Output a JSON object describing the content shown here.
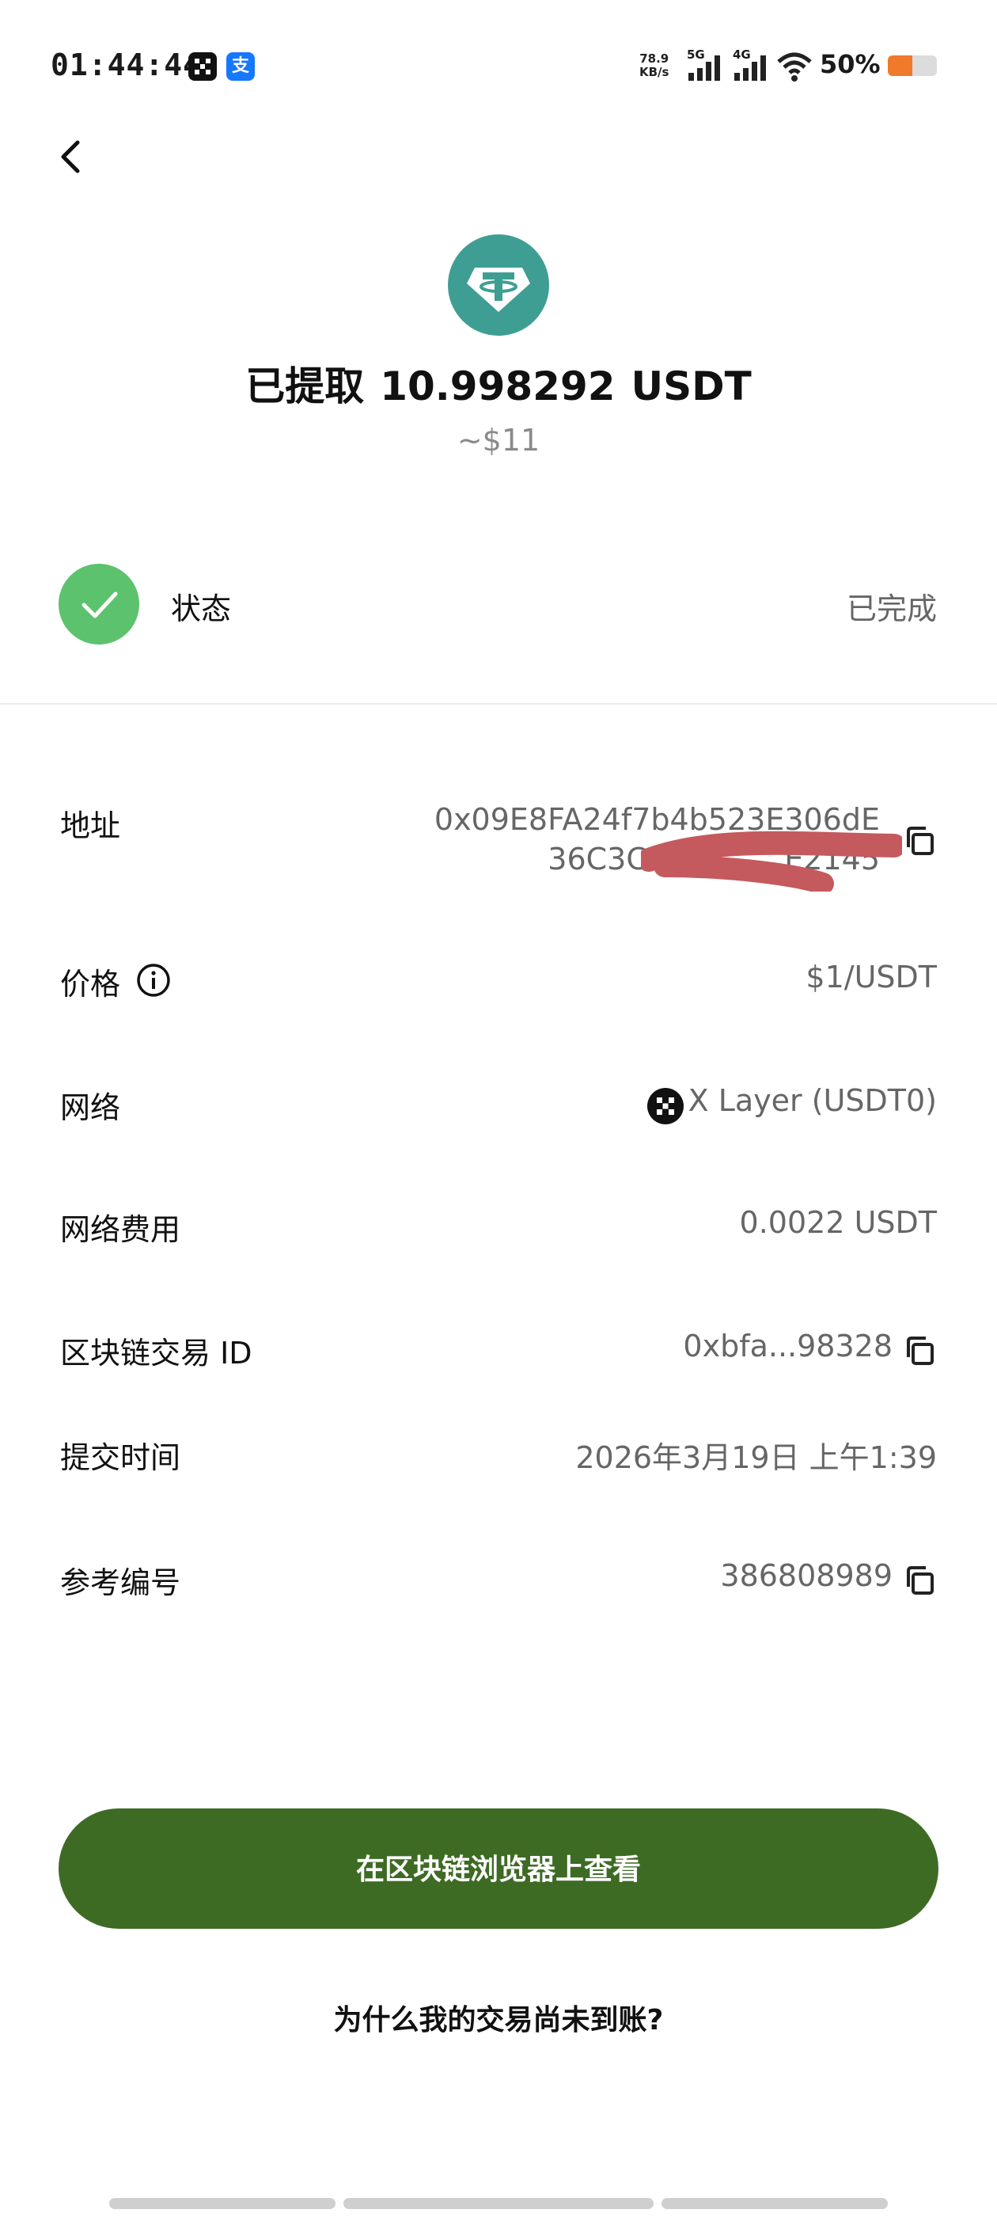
{
  "status_bar": {
    "time": "01:44:44",
    "okx_icon": "okx-icon",
    "alipay_icon_char": "支",
    "net_speed": "78.9",
    "net_speed_unit": "KB/s",
    "sim1": "5G",
    "sim2": "4G",
    "battery_text": "50%",
    "battery_level": 0.5,
    "battery_color": "#f07a2a"
  },
  "header": {
    "back_icon": "chevron-left-icon",
    "token_icon": "tether-icon",
    "title_prefix": "已提取",
    "amount": "10.998292",
    "token": "USDT",
    "usd_value": "~$11"
  },
  "status": {
    "label": "状态",
    "value": "已完成",
    "icon": "check-icon",
    "color": "#5cc26e"
  },
  "details": {
    "address_label": "地址",
    "address_line1": "0x09E8FA24f7b4b523E306dE",
    "address_line2": "36C3Ce",
    "address_line2_end": "E2145",
    "price_label": "价格",
    "price_value": "$1/USDT",
    "network_label": "网络",
    "network_value": "X Layer (USDT0)",
    "fee_label": "网络费用",
    "fee_value": "0.0022 USDT",
    "txid_label": "区块链交易 ID",
    "txid_value": "0xbfa...98328",
    "submit_time_label": "提交时间",
    "submit_time_value": "2026年3月19日 上午1:39",
    "ref_label": "参考编号",
    "ref_value": "386808989"
  },
  "actions": {
    "explorer_button": "在区块链浏览器上查看",
    "help_link": "为什么我的交易尚未到账?",
    "primary_color": "#3e6b24"
  }
}
